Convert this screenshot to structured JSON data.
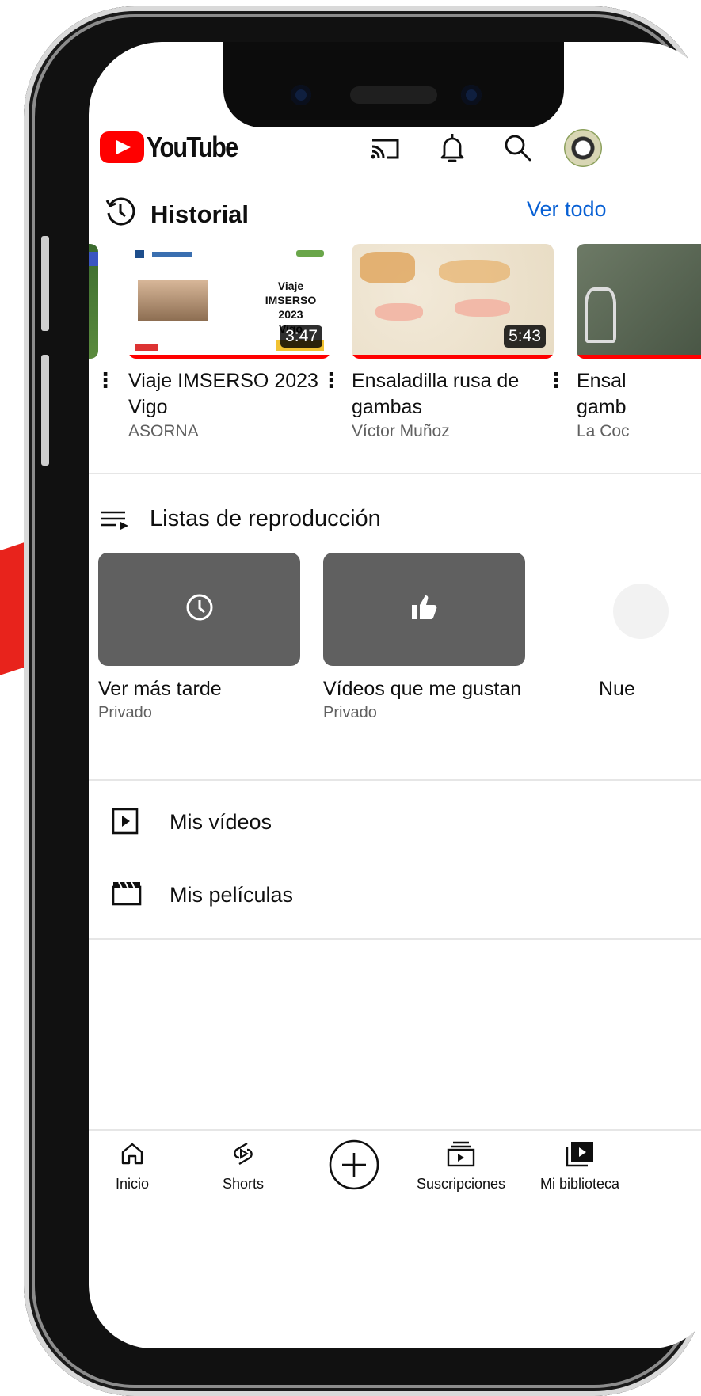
{
  "app": {
    "brand": "YouTube"
  },
  "header": {
    "icons": [
      "cast-icon",
      "bell-icon",
      "search-icon",
      "avatar"
    ]
  },
  "history": {
    "title": "Historial",
    "see_all": "Ver todo",
    "videos": [
      {
        "title_line1": "Viaje IMSERSO 2023",
        "title_line2": "Vigo",
        "channel": "ASORNA",
        "duration": "3:47",
        "thumb_text": [
          "Viaje IMSERSO",
          "2023",
          "Vigo"
        ],
        "progress": 1.0
      },
      {
        "title_line1": "Ensaladilla rusa de",
        "title_line2": "gambas",
        "channel": "Víctor Muñoz",
        "duration": "5:43",
        "progress": 1.0
      },
      {
        "title_line1": "Ensal",
        "title_line2": "gamb",
        "channel": "La Coc",
        "progress": 1.0
      }
    ]
  },
  "playlists": {
    "title": "Listas de reproducción",
    "items": [
      {
        "name": "Ver más tarde",
        "privacy": "Privado",
        "icon": "clock-icon"
      },
      {
        "name": "Vídeos que me gustan",
        "privacy": "Privado",
        "icon": "thumbs-up-icon"
      },
      {
        "name": "Nue",
        "icon": "plus-icon"
      }
    ]
  },
  "library_rows": [
    {
      "label": "Mis vídeos",
      "icon": "play-box-icon"
    },
    {
      "label": "Mis películas",
      "icon": "clapperboard-icon"
    }
  ],
  "bottom_nav": [
    {
      "label": "Inicio",
      "icon": "home-icon"
    },
    {
      "label": "Shorts",
      "icon": "shorts-icon"
    },
    {
      "label": "",
      "icon": "create-plus-icon"
    },
    {
      "label": "Suscripciones",
      "icon": "subscriptions-icon"
    },
    {
      "label": "Mi biblioteca",
      "icon": "library-icon"
    }
  ],
  "colors": {
    "brand_red": "#ff0000",
    "link_blue": "#065fd4",
    "tile_gray": "#606060",
    "pointer_red": "#e8231c"
  }
}
